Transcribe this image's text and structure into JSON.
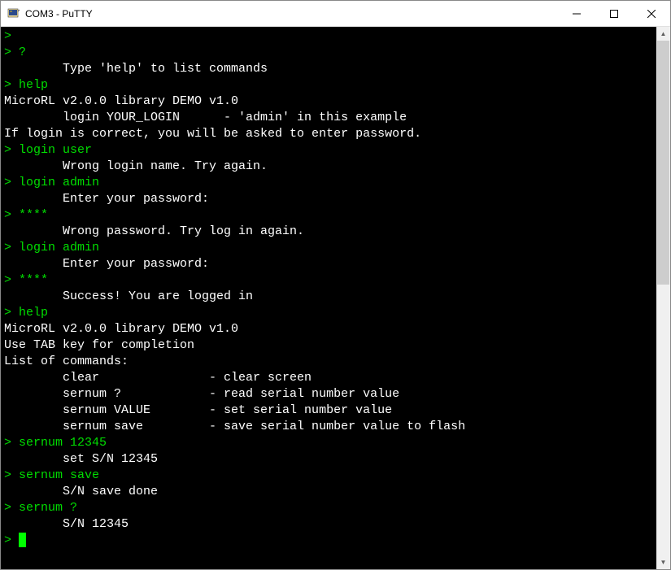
{
  "window": {
    "title": "COM3 - PuTTY"
  },
  "terminal": {
    "lines": [
      {
        "type": "prompt_only",
        "prompt": ">"
      },
      {
        "type": "cmd",
        "prompt": "> ",
        "text": "?"
      },
      {
        "type": "out",
        "text": "        Type 'help' to list commands"
      },
      {
        "type": "cmd",
        "prompt": "> ",
        "text": "help"
      },
      {
        "type": "out",
        "text": "MicroRL v2.0.0 library DEMO v1.0"
      },
      {
        "type": "out",
        "text": "        login YOUR_LOGIN      - 'admin' in this example"
      },
      {
        "type": "out",
        "text": "If login is correct, you will be asked to enter password."
      },
      {
        "type": "cmd",
        "prompt": "> ",
        "text": "login user"
      },
      {
        "type": "out",
        "text": "        Wrong login name. Try again."
      },
      {
        "type": "cmd",
        "prompt": "> ",
        "text": "login admin"
      },
      {
        "type": "out",
        "text": "        Enter your password:"
      },
      {
        "type": "cmd",
        "prompt": "> ",
        "text": "****"
      },
      {
        "type": "out",
        "text": "        Wrong password. Try log in again."
      },
      {
        "type": "cmd",
        "prompt": "> ",
        "text": "login admin"
      },
      {
        "type": "out",
        "text": "        Enter your password:"
      },
      {
        "type": "cmd",
        "prompt": "> ",
        "text": "****"
      },
      {
        "type": "out",
        "text": "        Success! You are logged in"
      },
      {
        "type": "cmd",
        "prompt": "> ",
        "text": "help"
      },
      {
        "type": "out",
        "text": "MicroRL v2.0.0 library DEMO v1.0"
      },
      {
        "type": "out",
        "text": "Use TAB key for completion"
      },
      {
        "type": "out",
        "text": "List of commands:"
      },
      {
        "type": "out",
        "text": "        clear               - clear screen"
      },
      {
        "type": "out",
        "text": "        sernum ?            - read serial number value"
      },
      {
        "type": "out",
        "text": "        sernum VALUE        - set serial number value"
      },
      {
        "type": "out",
        "text": "        sernum save         - save serial number value to flash"
      },
      {
        "type": "cmd",
        "prompt": "> ",
        "text": "sernum 12345"
      },
      {
        "type": "out",
        "text": "        set S/N 12345"
      },
      {
        "type": "cmd",
        "prompt": "> ",
        "text": "sernum save"
      },
      {
        "type": "out",
        "text": "        S/N save done"
      },
      {
        "type": "cmd",
        "prompt": "> ",
        "text": "sernum ?"
      },
      {
        "type": "out",
        "text": "        S/N 12345"
      },
      {
        "type": "cursor",
        "prompt": "> "
      }
    ]
  }
}
